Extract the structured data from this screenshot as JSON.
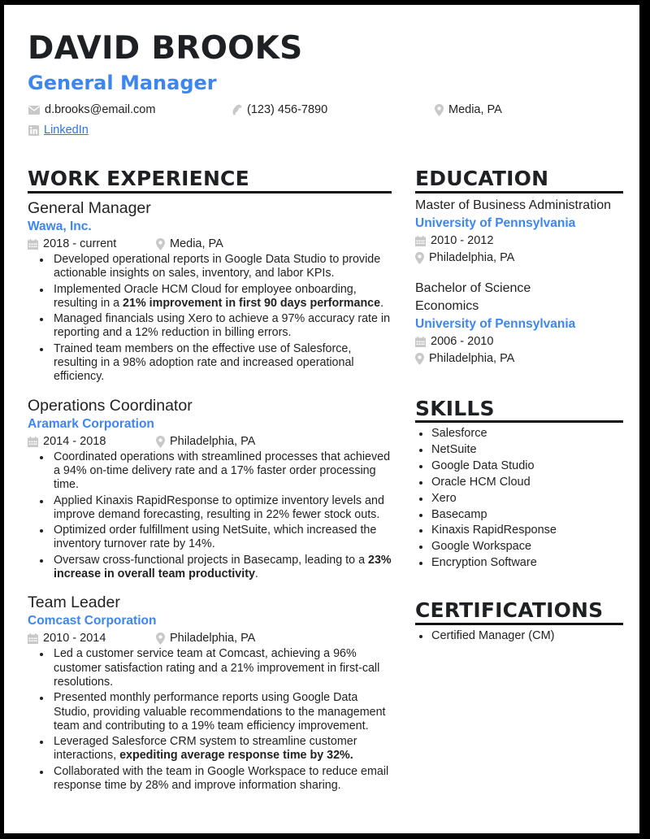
{
  "header": {
    "name": "DAVID BROOKS",
    "title": "General Manager",
    "contact": {
      "email": "d.brooks@email.com",
      "phone": "(123) 456-7890",
      "location": "Media, PA",
      "linkedin": "LinkedIn"
    },
    "icons": {
      "email": "envelope-icon",
      "phone": "phone-icon",
      "location": "map-pin-icon",
      "linkedin": "linkedin-icon",
      "date": "calendar-icon"
    }
  },
  "colors": {
    "accent": "#3d86f0",
    "text": "#222222",
    "heading": "#1f2023",
    "icon": "#c8c8c8",
    "border": "#000000"
  },
  "work": {
    "heading": "WORK EXPERIENCE",
    "jobs": [
      {
        "title": "General Manager",
        "company": "Wawa, Inc.",
        "dates": "2018 - current",
        "location": "Media, PA",
        "bullets": [
          {
            "pre": "Developed operational reports in Google Data Studio to provide actionable insights on sales, inventory, and labor KPIs.",
            "bold": "",
            "post": ""
          },
          {
            "pre": "Implemented Oracle HCM Cloud for employee onboarding, resulting in a ",
            "bold": "21% improvement in first 90 days performance",
            "post": "."
          },
          {
            "pre": "Managed financials using Xero to achieve a 97% accuracy rate in reporting and a 12% reduction in billing errors.",
            "bold": "",
            "post": ""
          },
          {
            "pre": "Trained team members on the effective use of Salesforce, resulting in a 98% adoption rate and increased operational efficiency.",
            "bold": "",
            "post": ""
          }
        ]
      },
      {
        "title": "Operations Coordinator",
        "company": "Aramark Corporation",
        "dates": "2014 - 2018",
        "location": "Philadelphia, PA",
        "bullets": [
          {
            "pre": "Coordinated operations with streamlined processes that achieved a 94% on-time delivery rate and a 17% faster order processing time.",
            "bold": "",
            "post": ""
          },
          {
            "pre": "Applied Kinaxis RapidResponse to optimize inventory levels and improve demand forecasting, resulting in 22% fewer stock outs.",
            "bold": "",
            "post": ""
          },
          {
            "pre": "Optimized order fulfillment using NetSuite, which increased the inventory turnover rate by 14%.",
            "bold": "",
            "post": ""
          },
          {
            "pre": "Oversaw cross-functional projects in Basecamp, leading to a ",
            "bold": "23% increase in overall team productivity",
            "post": "."
          }
        ]
      },
      {
        "title": "Team Leader",
        "company": "Comcast Corporation",
        "dates": "2010 - 2014",
        "location": "Philadelphia, PA",
        "bullets": [
          {
            "pre": "Led a customer service team at Comcast, achieving a 96% customer satisfaction rating and a 21% improvement in first-call resolutions.",
            "bold": "",
            "post": ""
          },
          {
            "pre": "Presented monthly performance reports using Google Data Studio, providing valuable recommendations to the management team and contributing to a 19% team efficiency improvement.",
            "bold": "",
            "post": ""
          },
          {
            "pre": "Leveraged Salesforce CRM system to streamline customer interactions, ",
            "bold": "expediting average response time by 32%.",
            "post": ""
          },
          {
            "pre": "Collaborated with the team in Google Workspace to reduce email response time by 28% and improve information sharing.",
            "bold": "",
            "post": ""
          }
        ]
      }
    ]
  },
  "education": {
    "heading": "EDUCATION",
    "entries": [
      {
        "degree": "Master of Business Administration",
        "field": "",
        "school": "University of Pennsylvania",
        "dates": "2010 - 2012",
        "location": "Philadelphia, PA"
      },
      {
        "degree": "Bachelor of Science",
        "field": "Economics",
        "school": "University of Pennsylvania",
        "dates": "2006 - 2010",
        "location": "Philadelphia, PA"
      }
    ]
  },
  "skills": {
    "heading": "SKILLS",
    "items": [
      "Salesforce",
      "NetSuite",
      "Google Data Studio",
      "Oracle HCM Cloud",
      "Xero",
      "Basecamp",
      "Kinaxis RapidResponse",
      "Google Workspace",
      "Encryption Software"
    ]
  },
  "certifications": {
    "heading": "CERTIFICATIONS",
    "items": [
      "Certified Manager (CM)"
    ]
  }
}
